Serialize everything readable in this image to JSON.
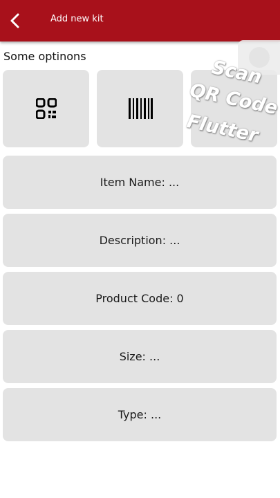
{
  "app_bar": {
    "title": "Add new kit",
    "background": "#a8111b",
    "back_icon": "chevron-left-icon"
  },
  "options": {
    "label": "Some optinons",
    "tiles": [
      {
        "icon": "qr-code-icon"
      },
      {
        "icon": "barcode-icon"
      },
      {
        "icon": ""
      }
    ]
  },
  "fields": [
    {
      "text": "Item Name: ..."
    },
    {
      "text": "Description: ..."
    },
    {
      "text": "Product Code: 0"
    },
    {
      "text": "Size: ..."
    },
    {
      "text": "Type: ..."
    }
  ],
  "watermark": {
    "line1": "Scan",
    "line2": "QR Code",
    "line3": "Flutter"
  }
}
